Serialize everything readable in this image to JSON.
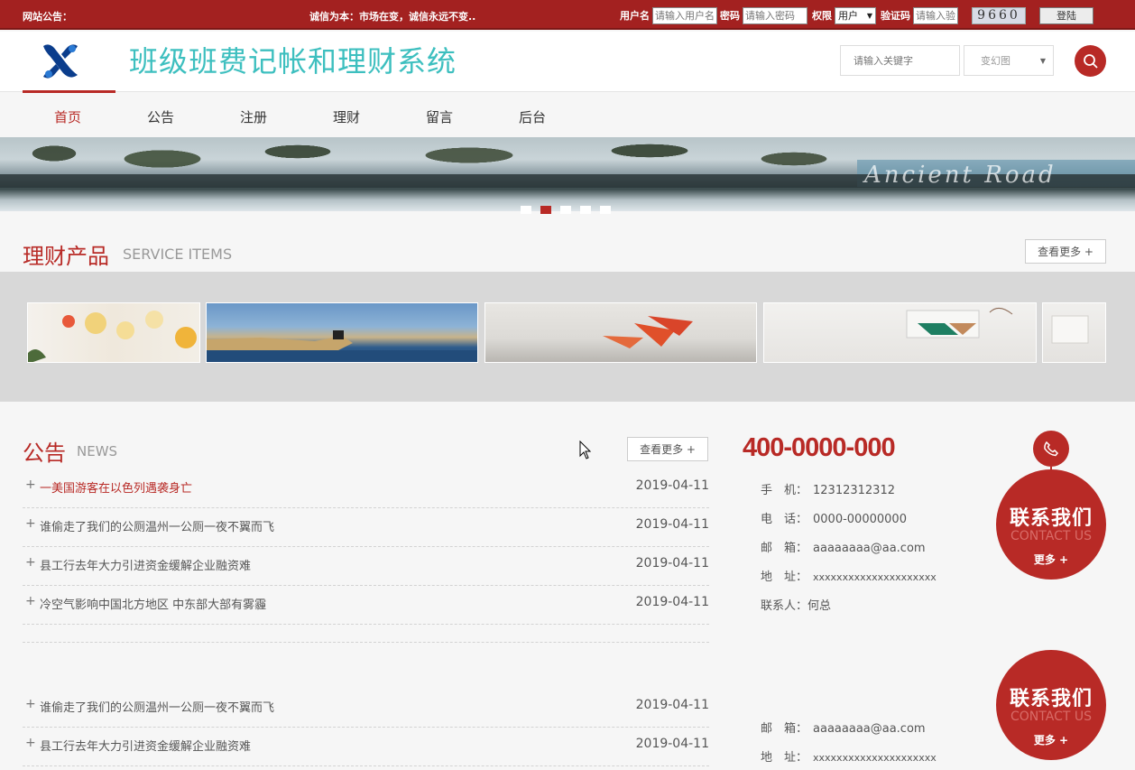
{
  "topbar": {
    "notice_label": "网站公告：",
    "notice_text": "诚信为本：市场在变，诚信永远不变..",
    "login": {
      "username_label": "用户名",
      "username_placeholder": "请输入用户名",
      "password_label": "密码",
      "password_placeholder": "请输入密码",
      "role_label": "权限",
      "role_value": "用户",
      "captcha_label": "验证码",
      "captcha_placeholder": "请输入验",
      "captcha_image_text": "9660",
      "login_button": "登陆"
    }
  },
  "header": {
    "site_title": "班级班费记帐和理财系统",
    "search_placeholder": "请输入关键字",
    "search_scope": "变幻图"
  },
  "nav": {
    "items": [
      "首页",
      "公告",
      "注册",
      "理财",
      "留言",
      "后台"
    ],
    "active": "首页"
  },
  "banner": {
    "sign_text": "Ancient Road",
    "slides": 5,
    "active_slide": 2
  },
  "products": {
    "title": "理财产品",
    "subtitle": "SERVICE ITEMS",
    "more": "查看更多 +"
  },
  "news": {
    "title": "公告",
    "subtitle": "NEWS",
    "more": "查看更多 +",
    "items": [
      {
        "title": "一美国游客在以色列遇袭身亡",
        "date": "2019-04-11"
      },
      {
        "title": "谁偷走了我们的公厕温州一公厕一夜不翼而飞",
        "date": "2019-04-11"
      },
      {
        "title": "县工行去年大力引进资金缓解企业融资难",
        "date": "2019-04-11"
      },
      {
        "title": "冷空气影响中国北方地区 中东部大部有雾霾",
        "date": "2019-04-11"
      },
      {
        "title": "谁偷走了我们的公厕温州一公厕一夜不翼而飞",
        "date": "2019-04-11"
      },
      {
        "title": "县工行去年大力引进资金缓解企业融资难",
        "date": "2019-04-11"
      }
    ]
  },
  "contact": {
    "hotline": "400-0000-000",
    "mobile_label": "手　机：",
    "mobile": "12312312312",
    "tel_label": "电　话：",
    "tel": "0000-00000000",
    "email_label": "邮　箱：",
    "email": "aaaaaaaa@aa.com",
    "addr_label": "地　址：",
    "addr": "xxxxxxxxxxxxxxxxxxxxx",
    "person_label": "联系人：",
    "person": "何总",
    "badge_cn": "联系我们",
    "badge_en": "CONTACT US",
    "badge_more": "更多 +"
  }
}
